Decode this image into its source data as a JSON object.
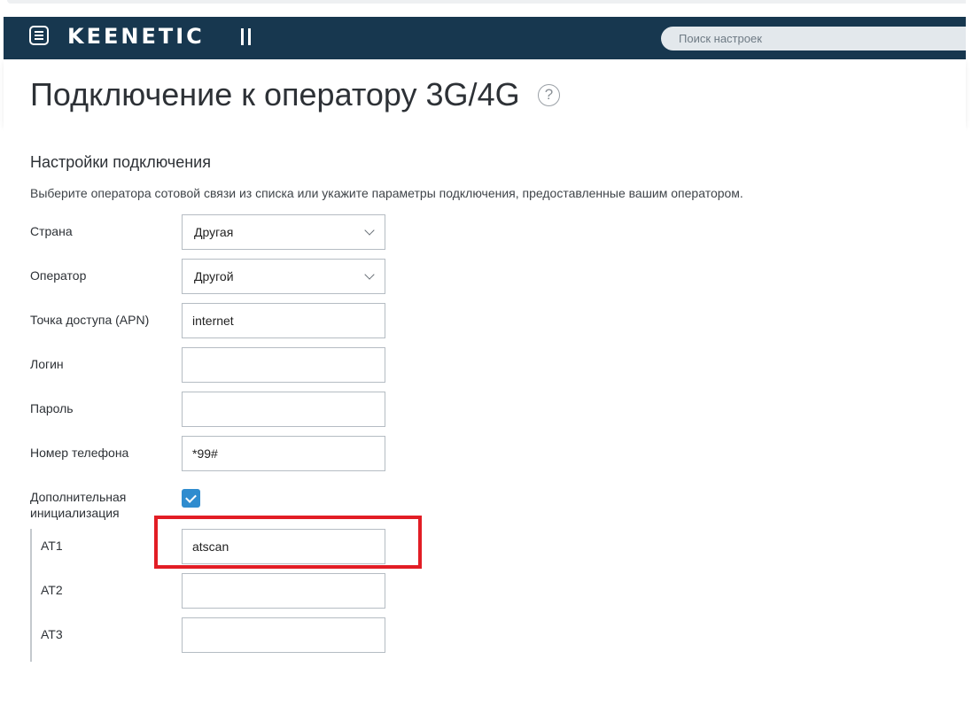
{
  "header": {
    "logo": "KEENETIC",
    "search_placeholder": "Поиск настроек"
  },
  "page": {
    "title": "Подключение к оператору 3G/4G",
    "help_icon_glyph": "?"
  },
  "section": {
    "title": "Настройки подключения",
    "description": "Выберите оператора сотовой связи из списка или укажите параметры подключения, предоставленные вашим оператором."
  },
  "form": {
    "country": {
      "label": "Страна",
      "value": "Другая"
    },
    "operator": {
      "label": "Оператор",
      "value": "Другой"
    },
    "apn": {
      "label": "Точка доступа (APN)",
      "value": "internet"
    },
    "login": {
      "label": "Логин",
      "value": ""
    },
    "password": {
      "label": "Пароль",
      "value": ""
    },
    "phone": {
      "label": "Номер телефона",
      "value": "*99#"
    },
    "extra_init": {
      "label": "Дополнительная инициализация",
      "checked": true
    },
    "at1": {
      "label": "AT1",
      "value": "atscan"
    },
    "at2": {
      "label": "AT2",
      "value": ""
    },
    "at3": {
      "label": "AT3",
      "value": ""
    }
  },
  "colors": {
    "header_bg": "#17374f",
    "accent": "#2f8ccf",
    "highlight": "#e21d25"
  }
}
